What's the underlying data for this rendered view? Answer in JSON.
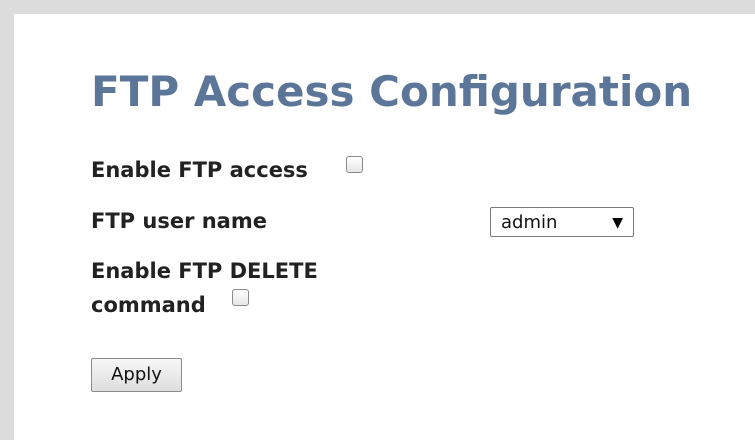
{
  "page": {
    "title": "FTP Access Configuration"
  },
  "form": {
    "enable_ftp_access_label": "Enable FTP access",
    "ftp_user_name_label": "FTP user name",
    "ftp_user_name_value": "admin",
    "select_arrow_icon": "▼",
    "enable_delete_label_line1": "Enable FTP DELETE",
    "enable_delete_label_line2": "command",
    "apply_label": "Apply"
  },
  "colors": {
    "title": "#5b7699",
    "frame": "#dcdcdc",
    "panel": "#ffffff"
  }
}
